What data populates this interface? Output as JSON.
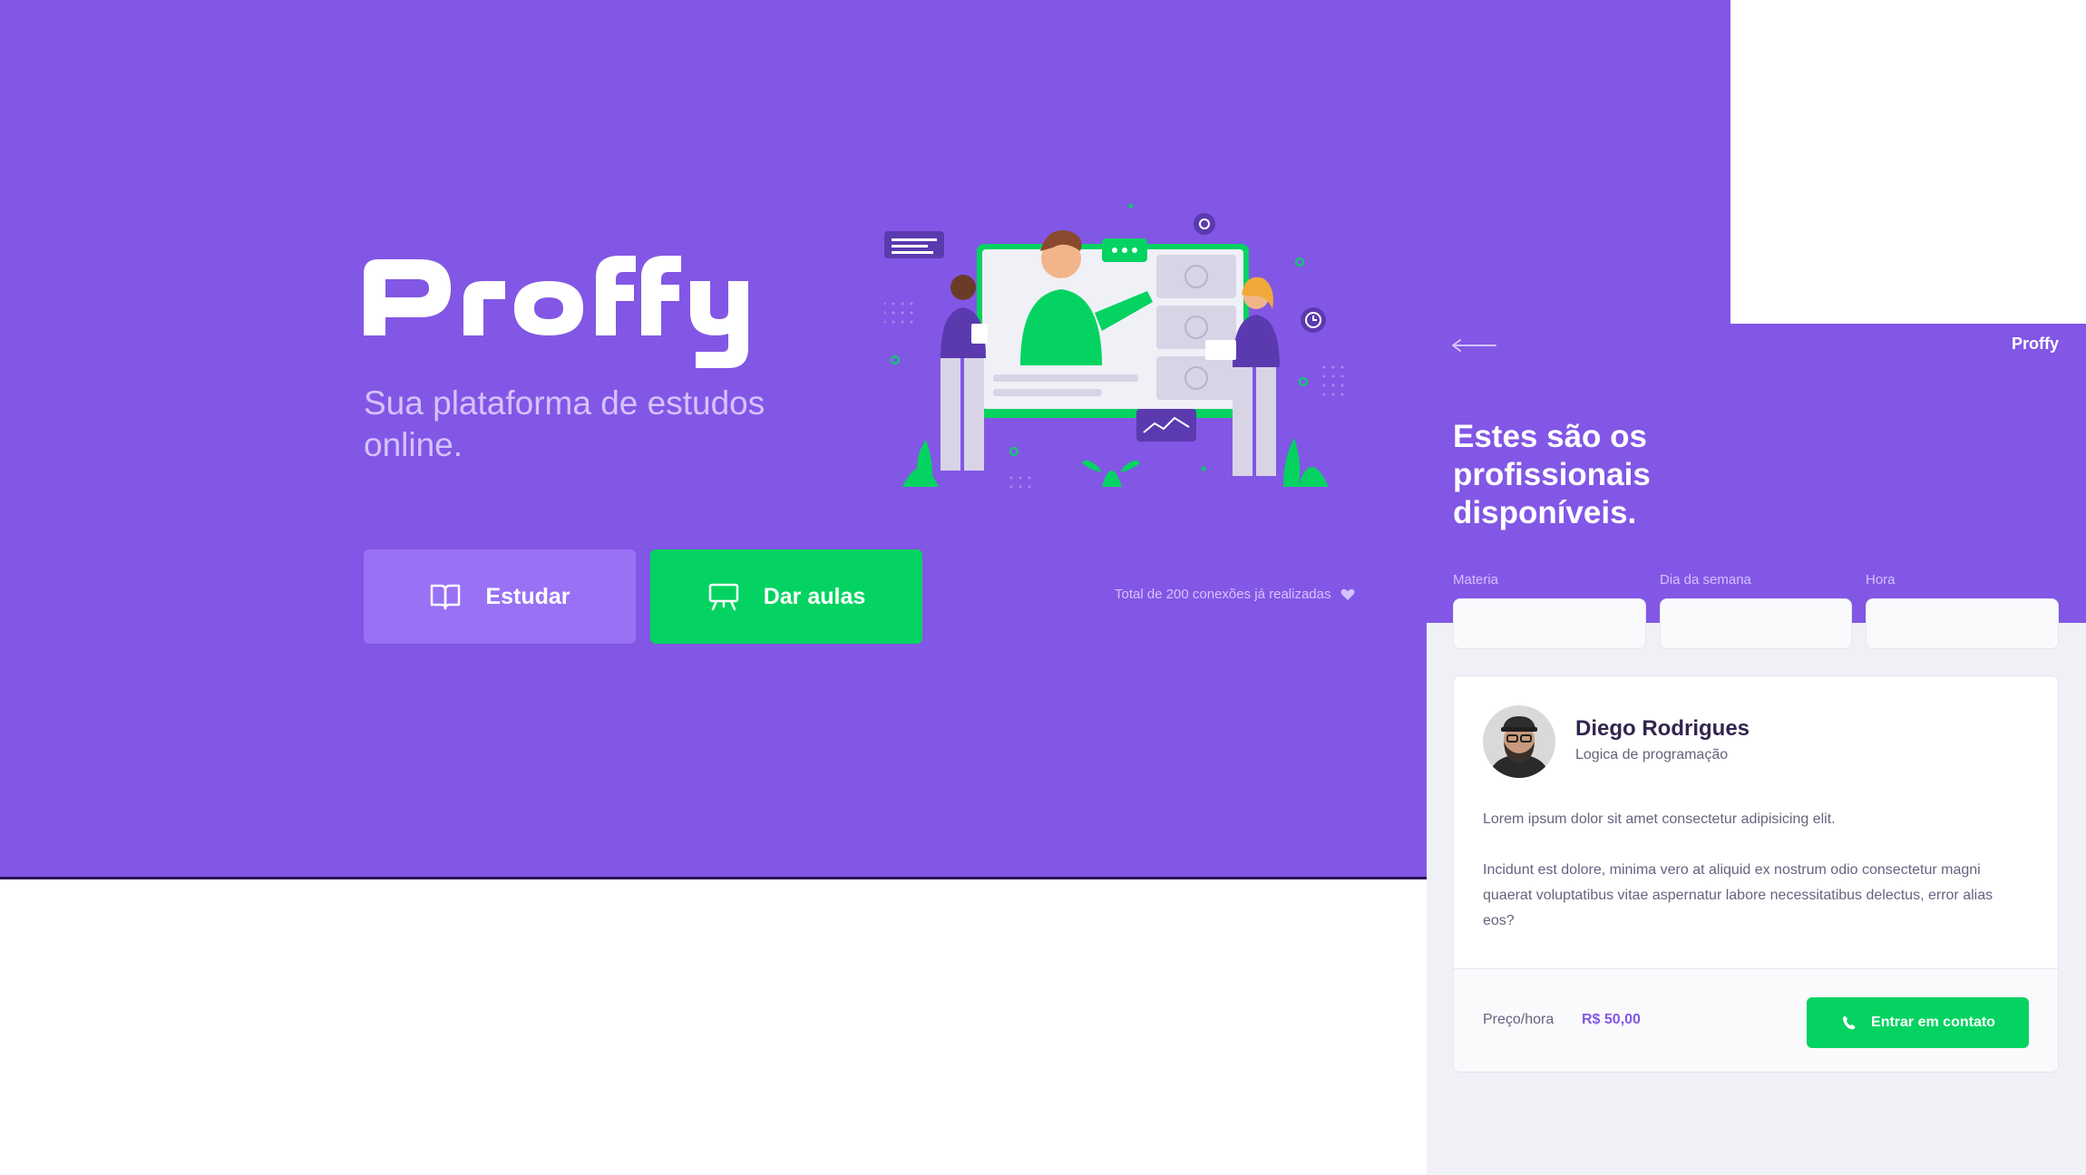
{
  "landing": {
    "logo_text": "Proffy",
    "tagline": "Sua plataforma de estudos online.",
    "buttons": {
      "study_label": "Estudar",
      "teach_label": "Dar aulas"
    },
    "connections_text": "Total de 200 conexões já realizadas",
    "icons": {
      "study": "book-open-icon",
      "teach": "presentation-board-icon",
      "connections": "heart-icon"
    }
  },
  "teacher_list": {
    "logo_text": "Proffy",
    "title": "Estes são os profissionais disponíveis.",
    "filters": [
      {
        "label": "Materia",
        "value": ""
      },
      {
        "label": "Dia da semana",
        "value": ""
      },
      {
        "label": "Hora",
        "value": ""
      }
    ],
    "teacher": {
      "name": "Diego Rodrigues",
      "subject": "Logica de programação",
      "bio": [
        "Lorem ipsum dolor sit amet consectetur adipisicing elit.",
        "Incidunt est dolore, minima vero at aliquid ex nostrum odio consectetur magni quaerat voluptatibus vitae aspernatur labore necessitatibus delectus, error alias eos?"
      ],
      "price_label": "Preço/hora",
      "price_value": "R$ 50,00",
      "contact_label": "Entrar em contato"
    }
  },
  "colors": {
    "primary": "#8257e5",
    "primary_light": "#9871f5",
    "secondary": "#04d361",
    "text_in_primary": "#d4c2ff",
    "title": "#32264d",
    "text": "#6a6180",
    "background": "#f0f0f7"
  }
}
